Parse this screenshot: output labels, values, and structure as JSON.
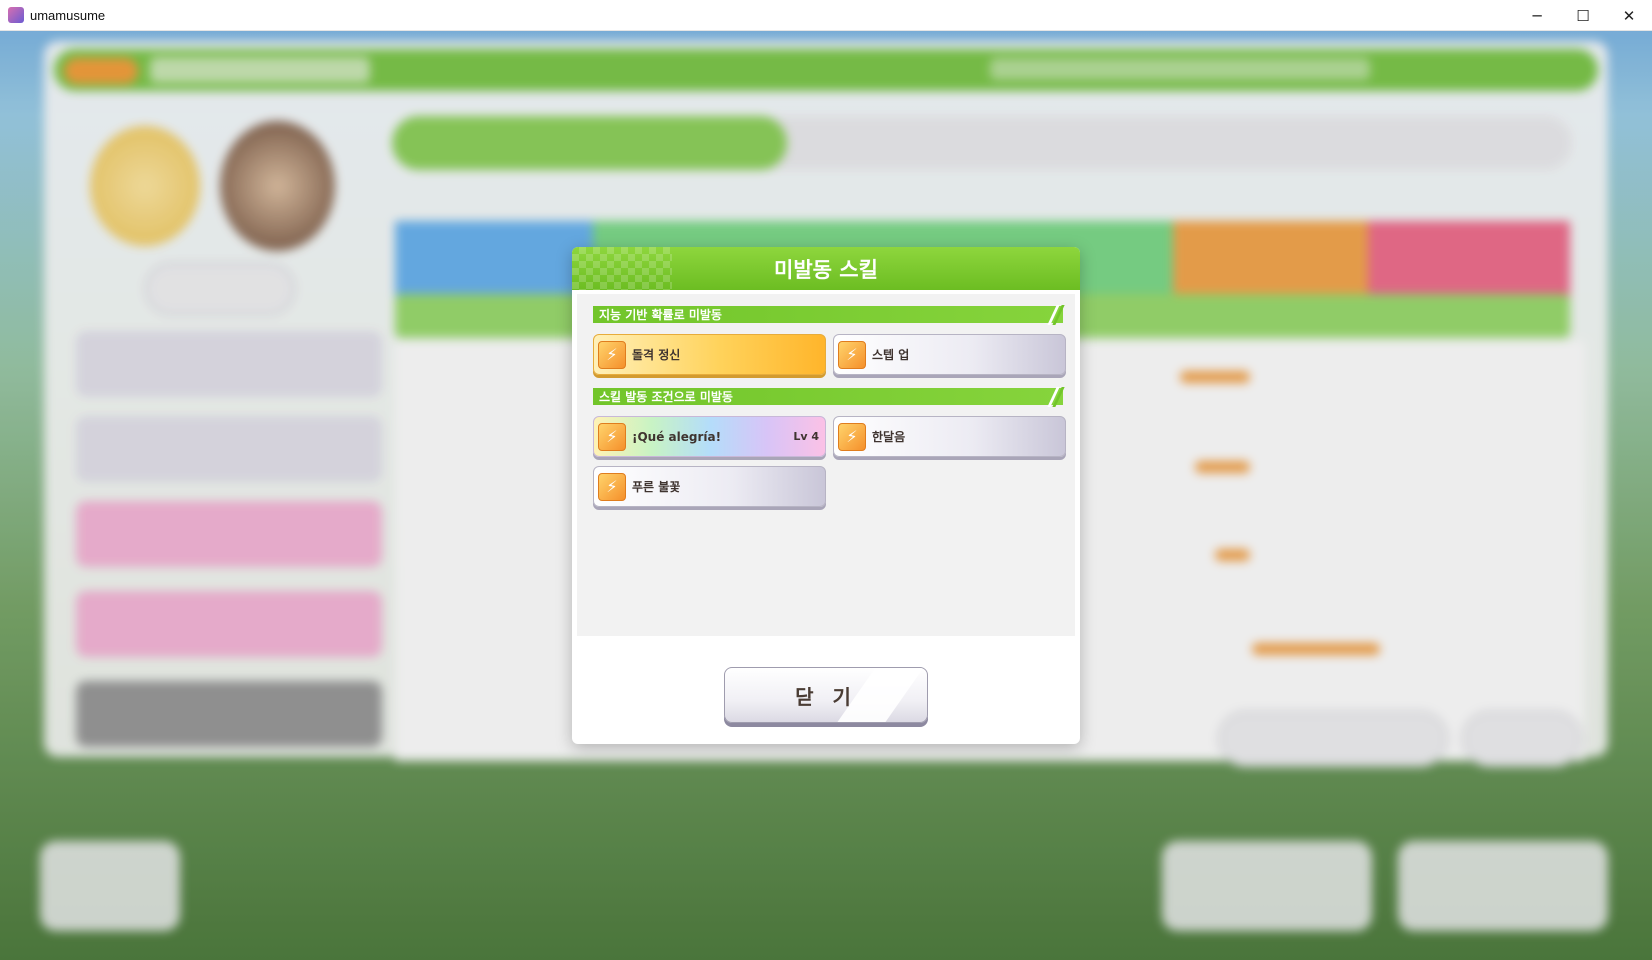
{
  "window": {
    "title": "umamusume",
    "controls": {
      "minimize": "─",
      "maximize": "☐",
      "close": "✕"
    }
  },
  "dialog": {
    "title": "미발동 스킬",
    "sections": [
      {
        "label": "지능 기반 확률로 미발동",
        "skills": [
          {
            "name": "돌격 정신",
            "rarity": "gold",
            "level": ""
          },
          {
            "name": "스텝 업",
            "rarity": "white",
            "level": ""
          }
        ]
      },
      {
        "label": "스킬 발동 조건으로 미발동",
        "skills": [
          {
            "name": "¡Qué alegría!",
            "rarity": "unique",
            "level": "Lv 4"
          },
          {
            "name": "한달음",
            "rarity": "white",
            "level": ""
          },
          {
            "name": "푸른 불꽃",
            "rarity": "white",
            "level": ""
          }
        ]
      }
    ],
    "close_label": "닫 기"
  },
  "colors": {
    "header_green": "#7dc72b",
    "section_green": "#72c52a",
    "gold_skill": "#ffd25a",
    "skill_icon": "#f5902b"
  },
  "icons": {
    "skill_icon": "running-umamusume-icon",
    "app_icon": "umamusume-app-icon"
  }
}
